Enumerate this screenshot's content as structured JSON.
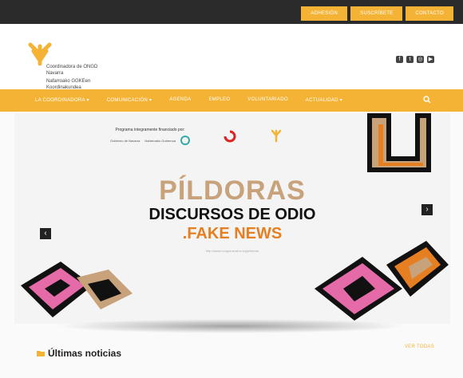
{
  "topbar": {
    "links": [
      "ADHESIÓN",
      "SUSCRÍBETE",
      "CONTACTO"
    ]
  },
  "logo": {
    "line1": "Coordinadora de ONGD Navarra",
    "line2": "Nafarroako GGKEen Koordinakundea"
  },
  "social": {
    "icons": [
      "facebook-icon",
      "twitter-icon",
      "instagram-icon",
      "youtube-icon"
    ]
  },
  "nav": {
    "items": [
      "LA COORDINADORA ▾",
      "COMUNICACIÓN ▾",
      "AGENDA",
      "EMPLEO",
      "VOLUNTARIADO",
      "ACTUALIDAD ▾"
    ]
  },
  "hero": {
    "sponsor_label": "Programa íntegramente financiado por:",
    "sponsor_1": "Gobierno de Navarra",
    "sponsor_2": "Nafarroako Gobernua",
    "title1": "PÍLDORAS",
    "title2": "DISCURSOS DE ODIO",
    "title3": ".FAKE NEWS",
    "url": "http://www.congdnavarra.org/pildoras"
  },
  "news": {
    "title": "Últimas noticias",
    "see_all": "VER TODAS"
  },
  "colors": {
    "accent": "#f5b335",
    "dark": "#2b2b2b",
    "pink": "#e56aa8",
    "tan": "#c7a27a",
    "orange": "#e67e22"
  }
}
